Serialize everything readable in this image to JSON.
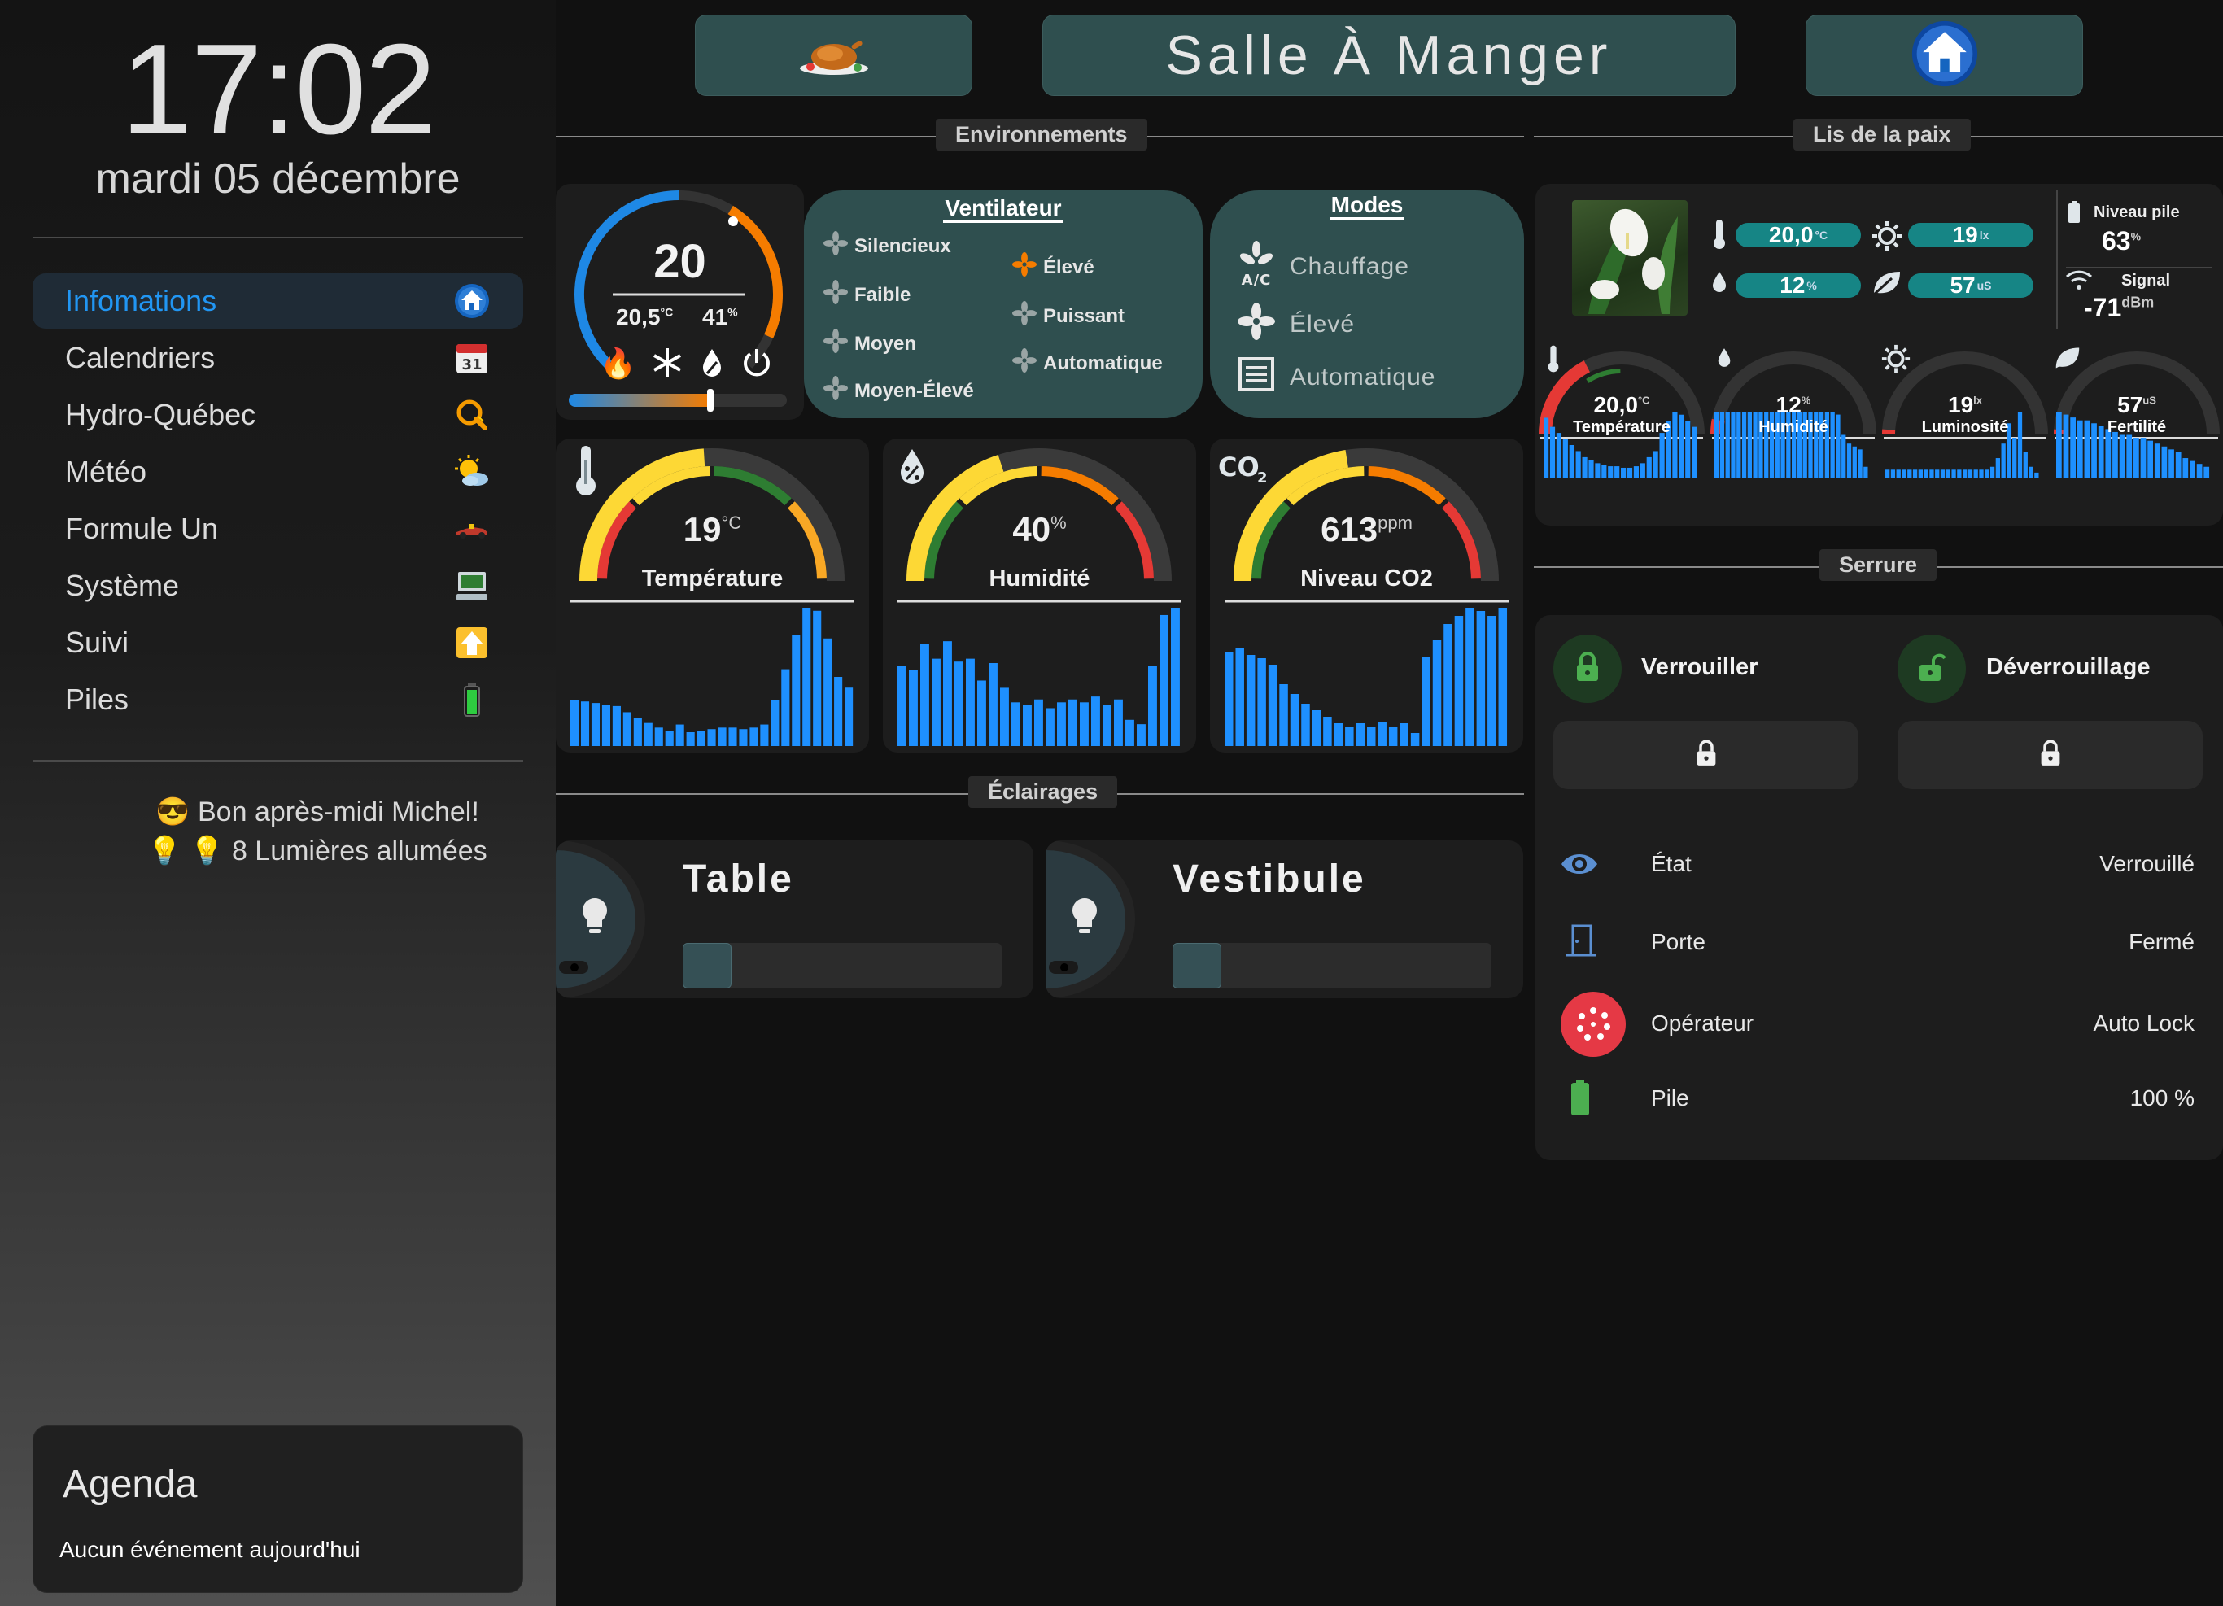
{
  "sidebar": {
    "time": "17:02",
    "date": "mardi 05 décembre",
    "items": [
      {
        "label": "Infomations",
        "icon": "home-icon",
        "active": true
      },
      {
        "label": "Calendriers",
        "icon": "calendar-icon"
      },
      {
        "label": "Hydro-Québec",
        "icon": "energy-icon"
      },
      {
        "label": "Météo",
        "icon": "weather-icon"
      },
      {
        "label": "Formule Un",
        "icon": "racecar-icon"
      },
      {
        "label": "Système",
        "icon": "computer-icon"
      },
      {
        "label": "Suivi",
        "icon": "arrow-up-icon"
      },
      {
        "label": "Piles",
        "icon": "battery-icon"
      }
    ],
    "greeting": "Bon après-midi Michel!",
    "lights_status": "8 Lumières allumées",
    "agenda": {
      "title": "Agenda",
      "text": "Aucun événement aujourd'hui"
    }
  },
  "header": {
    "title": "Salle À Manger",
    "left_icon": "turkey-icon",
    "right_icon": "home-icon"
  },
  "sections": {
    "environment": "Environnements",
    "plant": "Lis de la paix",
    "lock": "Serrure",
    "lights": "Éclairages"
  },
  "thermostat": {
    "setpoint": "20",
    "current_temp": "20,5",
    "temp_unit": "°C",
    "humidity": "41",
    "humidity_unit": "%",
    "level": 0.65,
    "mode_icons": [
      "fire-icon",
      "snowflake-icon",
      "drops-icon",
      "power-icon"
    ]
  },
  "fan": {
    "title": "Ventilateur",
    "left": [
      "Silencieux",
      "Faible",
      "Moyen",
      "Moyen-Élevé"
    ],
    "right": [
      "Élevé",
      "Puissant",
      "Automatique"
    ],
    "active": "Élevé"
  },
  "modes": {
    "title": "Modes",
    "items": [
      "Chauffage",
      "Élevé",
      "Automatique"
    ]
  },
  "gauges": [
    {
      "name": "Température",
      "value": "19",
      "unit": "°C",
      "icon": "thermometer-icon",
      "fraction": 0.48
    },
    {
      "name": "Humidité",
      "value": "40",
      "unit": "%",
      "icon": "water-percent-icon",
      "fraction": 0.4
    },
    {
      "name": "Niveau CO2",
      "value": "613",
      "unit": "ppm",
      "icon": "co2-icon",
      "fraction": 0.45
    }
  ],
  "plant": {
    "temperature": "20,0",
    "temperature_unit": "°C",
    "light": "19",
    "light_unit": "lx",
    "moisture": "12",
    "moisture_unit": "%",
    "conductivity": "57",
    "conductivity_unit": "uS",
    "battery_label": "Niveau pile",
    "battery_value": "63",
    "battery_unit": "%",
    "signal_label": "Signal",
    "signal_value": "-71",
    "signal_unit": "dBm",
    "gauges": [
      {
        "name": "Température",
        "value": "20,0",
        "unit": "°C",
        "icon": "thermometer-icon",
        "fraction": 0.35
      },
      {
        "name": "Humidité",
        "value": "12",
        "unit": "%",
        "icon": "water-percent-icon",
        "fraction": 0.06
      },
      {
        "name": "Luminosité",
        "value": "19",
        "unit": "lx",
        "icon": "sun-icon",
        "fraction": 0.02
      },
      {
        "name": "Fertilité",
        "value": "57",
        "unit": "uS",
        "icon": "leaf-icon",
        "fraction": 0.02
      }
    ]
  },
  "lock": {
    "lock_label": "Verrouiller",
    "unlock_label": "Déverrouillage",
    "rows": [
      {
        "label": "État",
        "value": "Verrouillé",
        "icon": "eye-icon"
      },
      {
        "label": "Porte",
        "value": "Fermé",
        "icon": "door-icon"
      },
      {
        "label": "Opérateur",
        "value": "Auto Lock",
        "icon": "operator-icon"
      },
      {
        "label": "Pile",
        "value": "100 %",
        "icon": "battery-icon"
      }
    ]
  },
  "lights": [
    {
      "name": "Table",
      "brightness": 0.0
    },
    {
      "name": "Vestibule",
      "brightness": 0.0
    }
  ],
  "colors": {
    "accent": "#2196f3",
    "teal": "#2f4f4f",
    "chip": "#168585",
    "bar": "#1e90ff",
    "orange": "#f57c00"
  }
}
